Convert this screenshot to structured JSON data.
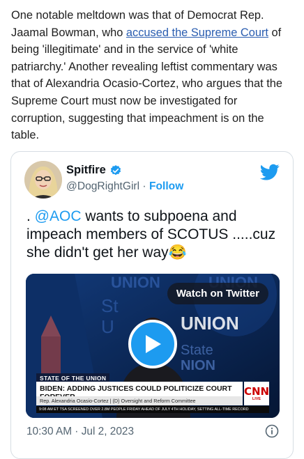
{
  "article": {
    "p1": "One notable meltdown was that of Democrat Rep. Jaamal Bowman, who ",
    "link": "accused the Supreme Court",
    "p2": " of being 'illegitimate' and in the service of 'white patriarchy.'  Another revealing leftist commentary was that of Alexandria Ocasio-Cortez, who argues that the Supreme Court must now be investigated for corruption, suggesting that impeachment is on the table."
  },
  "tweet": {
    "name": "Spitfire",
    "handle": "@DogRightGirl",
    "separator": " · ",
    "follow": "Follow",
    "text_pre": ". ",
    "mention": "@AOC",
    "text_post": " wants to subpoena and impeach members of SCOTUS .....cuz she didn't get her way😂",
    "timestamp": "10:30 AM · Jul 2, 2023"
  },
  "media": {
    "watch_label": "Watch on Twitter",
    "bg_text_1": "UNION",
    "bg_text_2": "State of the UNION",
    "show_tag": "STATE OF THE UNION",
    "headline": "BIDEN: ADDING JUSTICES COULD POLITICIZE COURT FOREVER",
    "subline": "Rep. Alexandria Ocasio-Cortez  |  (D) Oversight and Reform Committee",
    "ticker": "9:08 AM ET    TSA SCREENED OVER 2.8M PEOPLE FRIDAY AHEAD OF JULY 4TH HOLIDAY, SETTING ALL-TIME RECORD",
    "network": "CNN",
    "live": "LIVE"
  },
  "colors": {
    "link": "#2a5db0",
    "twitter_blue": "#1d9bf0",
    "cnn_red": "#cc0000"
  },
  "icons": [
    "verified-badge-icon",
    "twitter-bird-icon",
    "play-icon",
    "info-icon"
  ]
}
